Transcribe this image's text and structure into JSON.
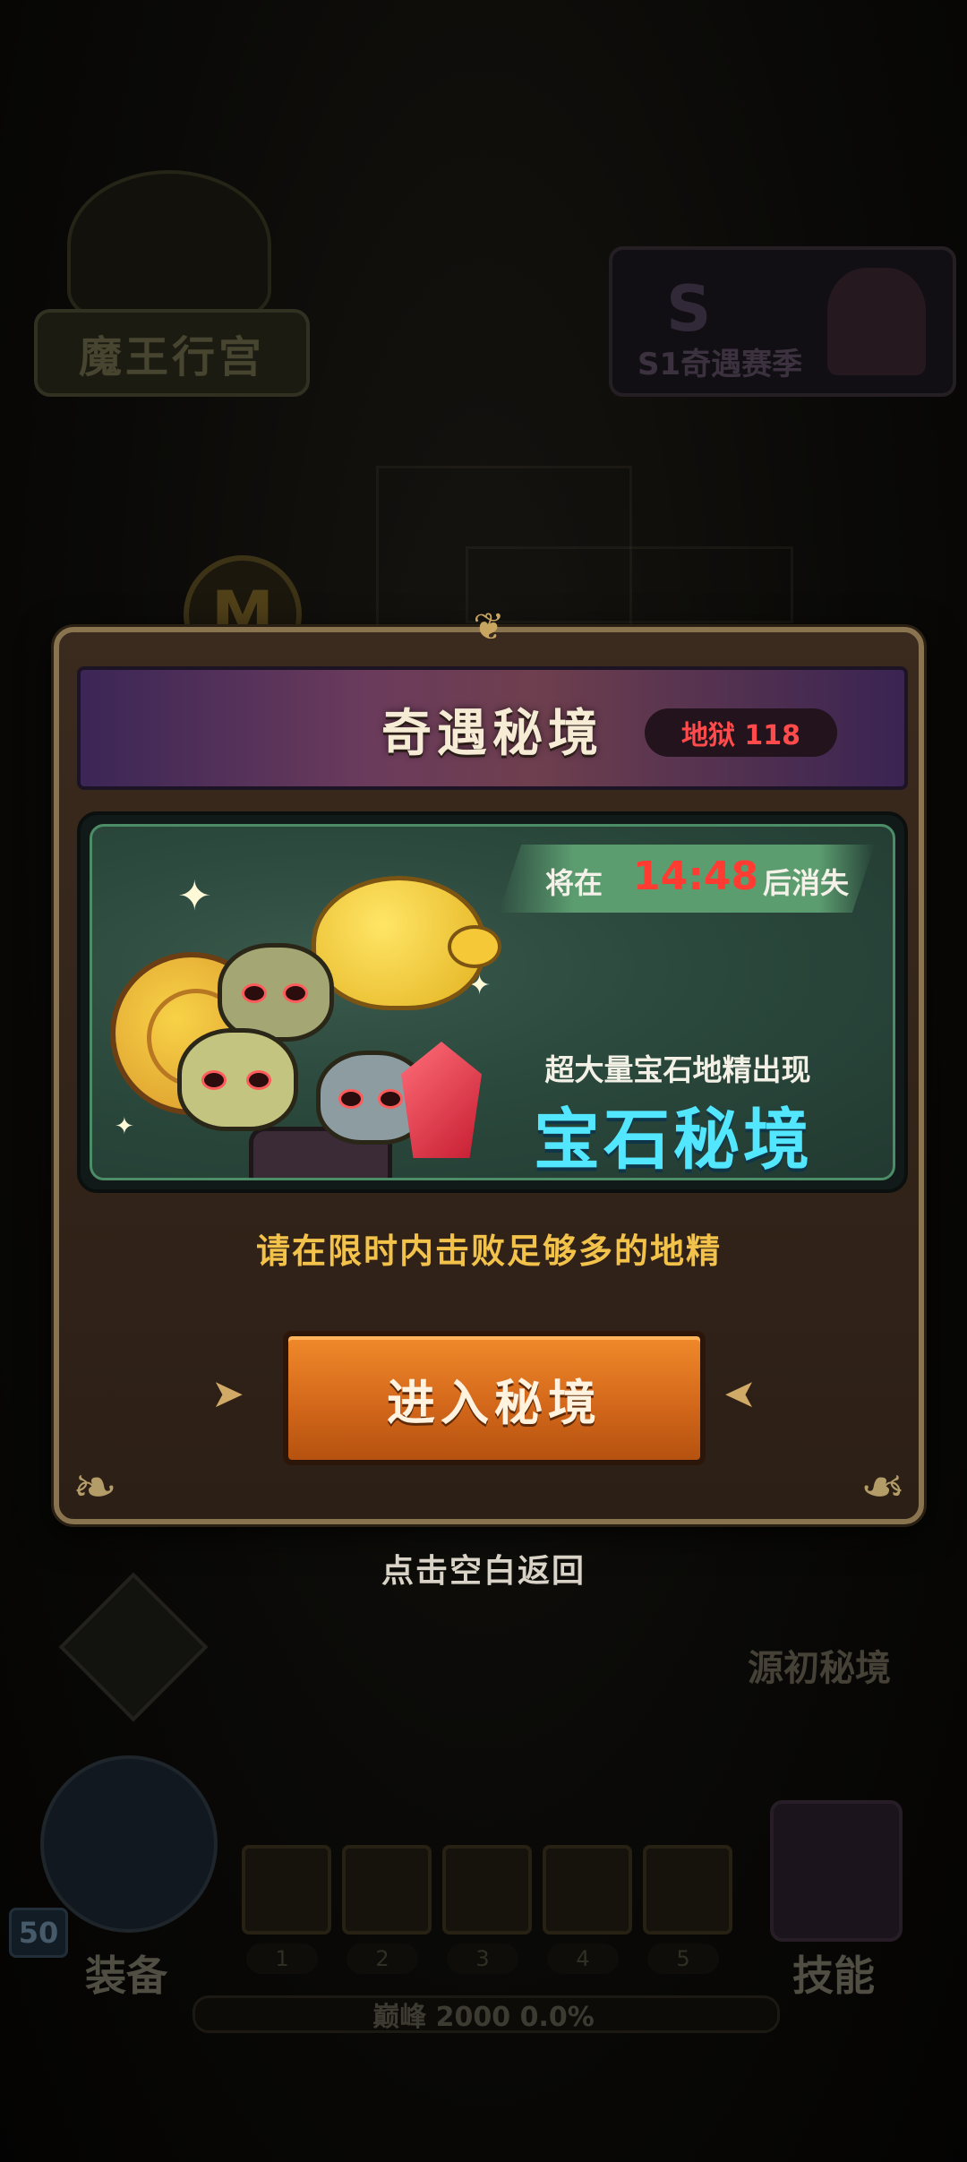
{
  "background": {
    "palace_label": "魔王行宫",
    "season_label": "S1奇遇赛季",
    "season_logo": "S",
    "m_badge": "M",
    "origin_label": "源初秘境",
    "equip_label": "装备",
    "skill_label": "技能",
    "hero_level": "50",
    "slot_numbers": [
      "1",
      "2",
      "3",
      "4",
      "5"
    ],
    "peak_label": "巅峰 2000   0.0%"
  },
  "dialog": {
    "title": "奇遇秘境",
    "difficulty_badge": "地狱 118",
    "timer_prefix": "将在",
    "timer_value": "14:48",
    "timer_suffix": "后消失",
    "subtitle": "超大量宝石地精出现",
    "realm_name": "宝石秘境",
    "hint": "请在限时内击败足够多的地精",
    "enter_button": "进入秘境"
  },
  "tap_back": "点击空白返回",
  "colors": {
    "accent_orange": "#e07a22",
    "realm_cyan": "#53e7ff",
    "timer_red": "#ff3b32",
    "hint_gold": "#f3c24a",
    "badge_red": "#ff4b4b"
  }
}
